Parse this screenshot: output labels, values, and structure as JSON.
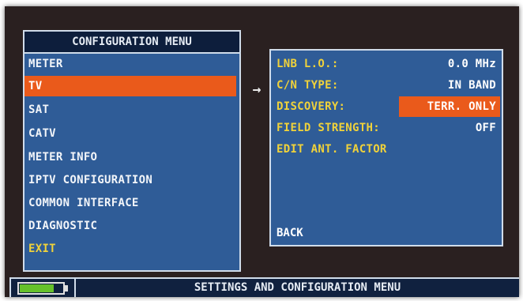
{
  "config_menu": {
    "title": "CONFIGURATION MENU",
    "items": [
      {
        "label": "METER"
      },
      {
        "label": "TV"
      },
      {
        "label": "SAT"
      },
      {
        "label": "CATV"
      },
      {
        "label": "METER INFO"
      },
      {
        "label": "IPTV CONFIGURATION"
      },
      {
        "label": "COMMON INTERFACE"
      },
      {
        "label": "DIAGNOSTIC"
      },
      {
        "label": "EXIT"
      }
    ],
    "selected": "TV"
  },
  "arrow": "→",
  "tv_submenu": {
    "rows": [
      {
        "label": "LNB L.O.:",
        "value": "0.0 MHz"
      },
      {
        "label": "C/N TYPE:",
        "value": "IN BAND"
      },
      {
        "label": "DISCOVERY:",
        "value": "TERR. ONLY"
      },
      {
        "label": "FIELD STRENGTH:",
        "value": "OFF"
      },
      {
        "label": "EDIT ANT. FACTOR",
        "value": ""
      }
    ],
    "back_label": "BACK"
  },
  "status_bar": {
    "text": "SETTINGS AND CONFIGURATION MENU",
    "battery_level": 0.82
  },
  "colors": {
    "panel": "#2f5c97",
    "highlight": "#ea5a1b",
    "label_yellow": "#f0d23a",
    "battery_green": "#66c12a",
    "title_bar": "#0d1e3c"
  }
}
